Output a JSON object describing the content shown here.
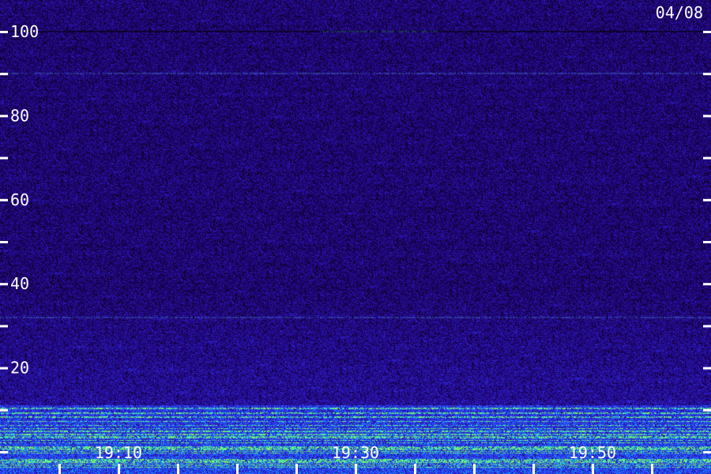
{
  "chart_data": {
    "type": "heatmap",
    "title": "",
    "date": "04/08",
    "xlabel": "",
    "ylabel": "",
    "ylim": [
      0,
      100
    ],
    "y_ticks": [
      20,
      40,
      60,
      80,
      100
    ],
    "y_minor_ticks": [
      0,
      10,
      30,
      50,
      70,
      90
    ],
    "x_ticks": [
      "19:10",
      "19:30",
      "19:50"
    ],
    "x_range": [
      "19:05",
      "19:55"
    ],
    "x_minor_step_minutes": 5,
    "colormap": [
      "#000000",
      "#1a0050",
      "#2a10b0",
      "#3040ff",
      "#00d0ff",
      "#80ff60"
    ],
    "features": [
      {
        "type": "band",
        "y_from": 0,
        "y_to": 10,
        "intensity": "high"
      },
      {
        "type": "line",
        "y": 100,
        "x_from": "19:27",
        "x_to": "19:37",
        "intensity": "medium"
      },
      {
        "type": "line",
        "y": 90,
        "intensity": "low"
      },
      {
        "type": "line",
        "y": 32,
        "intensity": "low"
      }
    ]
  }
}
